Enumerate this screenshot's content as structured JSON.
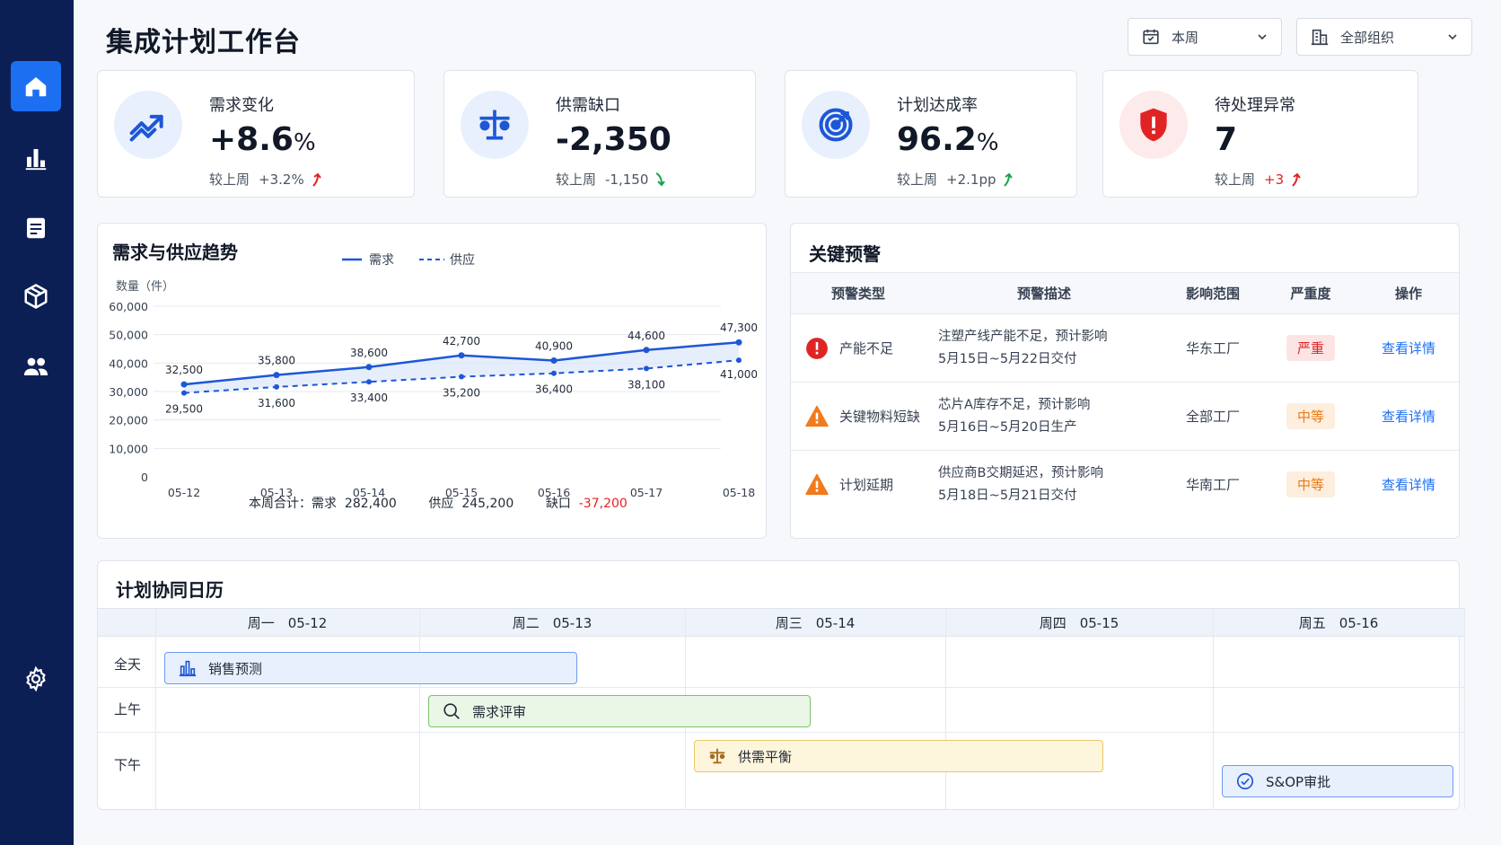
{
  "header": {
    "title": "集成计划工作台",
    "period_select": "本周",
    "org_select": "全部组织"
  },
  "nav": [
    "home-icon",
    "bar-chart-icon",
    "document-icon",
    "cube-icon",
    "users-icon",
    "settings-icon"
  ],
  "kpis": [
    {
      "label": "需求变化",
      "value": "+8.6",
      "unit": "%",
      "cmp_label": "较上周",
      "delta": "+3.2%",
      "trend": "up",
      "color": "#e02424"
    },
    {
      "label": "供需缺口",
      "value": "-2,350",
      "unit": "",
      "cmp_label": "较上周",
      "delta": "-1,150",
      "trend": "down",
      "color": "#16a34a"
    },
    {
      "label": "计划达成率",
      "value": "96.2",
      "unit": "%",
      "cmp_label": "较上周",
      "delta": "+2.1pp",
      "trend": "up",
      "color": "#16a34a"
    },
    {
      "label": "待处理异常",
      "value": "7",
      "unit": "",
      "cmp_label": "较上周",
      "delta": "+3",
      "trend": "up",
      "color": "#e02424"
    }
  ],
  "trend": {
    "title": "需求与供应趋势",
    "summary": {
      "label": "本周合计：",
      "demand_label": "需求",
      "demand": "282,400",
      "supply_label": "供应",
      "supply": "245,200",
      "gap_label": "缺口",
      "gap": "-37,200"
    }
  },
  "chart_data": {
    "type": "line",
    "title": "需求与供应趋势",
    "ylabel": "数量（件）",
    "x": [
      "05-12",
      "05-13",
      "05-14",
      "05-15",
      "05-16",
      "05-17",
      "05-18"
    ],
    "series": [
      {
        "name": "需求",
        "values": [
          32500,
          35800,
          38600,
          42700,
          40900,
          44600,
          47300
        ],
        "style": "solid"
      },
      {
        "name": "供应",
        "values": [
          29500,
          31600,
          33400,
          35200,
          36400,
          38100,
          41000
        ],
        "style": "dashed"
      }
    ],
    "ylim": [
      0,
      60000
    ],
    "yticks": [
      "0",
      "10,000",
      "20,000",
      "30,000",
      "40,000",
      "50,000",
      "60,000"
    ],
    "grid": true,
    "legend": "top"
  },
  "alerts": {
    "title": "关键预警",
    "columns": [
      "预警类型",
      "预警描述",
      "影响范围",
      "严重度",
      "操作"
    ],
    "rows": [
      {
        "icon": "error-icon",
        "type": "产能不足",
        "desc1": "注塑产线产能不足，预计影响",
        "desc2": "5月15日~5月22日交付",
        "scope": "华东工厂",
        "severity": "严重",
        "level": "red",
        "action": "查看详情"
      },
      {
        "icon": "warning-icon",
        "type": "关键物料短缺",
        "desc1": "芯片A库存不足，预计影响",
        "desc2": "5月16日~5月20日生产",
        "scope": "全部工厂",
        "severity": "中等",
        "level": "orange",
        "action": "查看详情"
      },
      {
        "icon": "warning-icon",
        "type": "计划延期",
        "desc1": "供应商B交期延迟，预计影响",
        "desc2": "5月18日~5月21日交付",
        "scope": "华南工厂",
        "severity": "中等",
        "level": "orange",
        "action": "查看详情"
      }
    ]
  },
  "calendar": {
    "title": "计划协同日历",
    "days": [
      "周一　05-12",
      "周二　05-13",
      "周三　05-14",
      "周四　05-15",
      "周五　05-16"
    ],
    "rows": [
      "全天",
      "上午",
      "下午"
    ],
    "events": [
      {
        "label": "销售预测",
        "icon": "bar-chart-icon"
      },
      {
        "label": "需求评审",
        "icon": "search-icon"
      },
      {
        "label": "供需平衡",
        "icon": "scale-icon"
      },
      {
        "label": "S&OP审批",
        "icon": "check-circle-icon"
      }
    ]
  }
}
